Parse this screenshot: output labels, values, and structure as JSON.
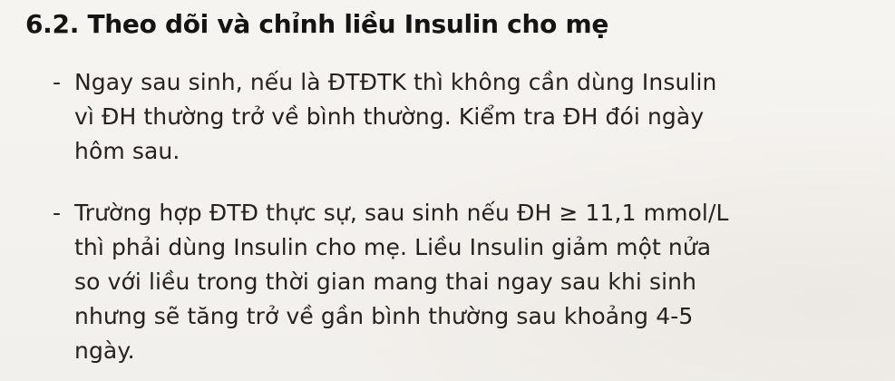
{
  "section": {
    "title": "6.2. Theo dõi và chỉnh liều Insulin cho mẹ"
  },
  "bullets": [
    {
      "marker": "-",
      "lines": [
        "Ngay sau sinh, nếu là ĐTĐTK thì không cần dùng Insulin",
        "vì ĐH thường trở về bình thường. Kiểm tra ĐH đói ngày",
        "hôm sau."
      ]
    },
    {
      "marker": "-",
      "lines": [
        "Trường hợp ĐTĐ thực sự, sau sinh nếu ĐH ≥ 11,1 mmol/L",
        "thì phải dùng Insulin cho mẹ. Liều Insulin giảm một nửa",
        "so với liều trong thời gian mang thai ngay sau khi sinh",
        "nhưng sẽ tăng trở về gần bình thường sau khoảng 4-5",
        "ngày."
      ]
    }
  ]
}
